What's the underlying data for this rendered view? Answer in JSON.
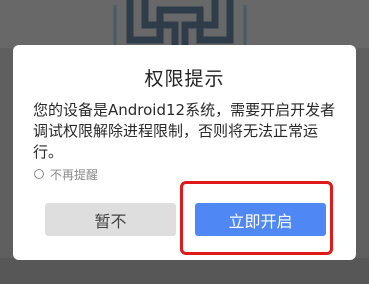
{
  "dialog": {
    "title": "权限提示",
    "message": "您的设备是Android12系统，需要开启开发者调试权限解除进程限制，否则将无法正常运行。",
    "no_remind_label": "不再提醒",
    "cancel_label": "暂不",
    "open_label": "立即开启"
  },
  "colors": {
    "accent": "#4f87f5",
    "highlight": "#e0191b",
    "cancel_bg": "#dedede"
  }
}
